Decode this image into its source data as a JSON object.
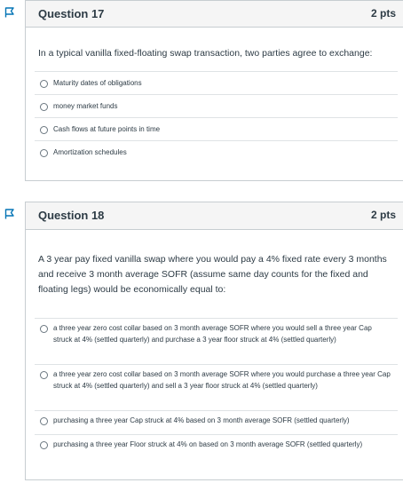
{
  "q17": {
    "title": "Question 17",
    "points": "2 pts",
    "text": "In a typical vanilla fixed-floating swap transaction, two parties agree to exchange:",
    "answers": [
      "Maturity dates of obligations",
      "money market funds",
      "Cash flows at future points in time",
      "Amortization schedules"
    ]
  },
  "q18": {
    "title": "Question 18",
    "points": "2 pts",
    "text": "A 3 year pay fixed vanilla swap where you would pay a 4% fixed rate every 3 months and receive 3 month average SOFR (assume same day counts for the fixed and floating legs) would be economically equal to:",
    "answers": [
      "a three year zero cost collar based on 3 month average SOFR where you would sell a three year Cap struck at 4% (settled quarterly) and purchase a 3 year floor struck at 4% (settled quarterly)",
      "a three year zero cost collar based on 3 month average SOFR where you would purchase a three year Cap struck at 4% (settled quarterly) and sell a 3 year floor struck at 4% (settled quarterly)",
      "purchasing a three year Cap struck at 4% based on 3 month average SOFR (settled quarterly)",
      "purchasing a three year Floor struck at 4% on based on 3 month average SOFR (settled quarterly)"
    ]
  },
  "colors": {
    "flag": "#0374b5",
    "border": "#c7cdd1",
    "header_bg": "#f5f5f5",
    "text": "#2d3b45"
  },
  "icons": {
    "flag": "flag-icon",
    "radio": "radio-button"
  }
}
